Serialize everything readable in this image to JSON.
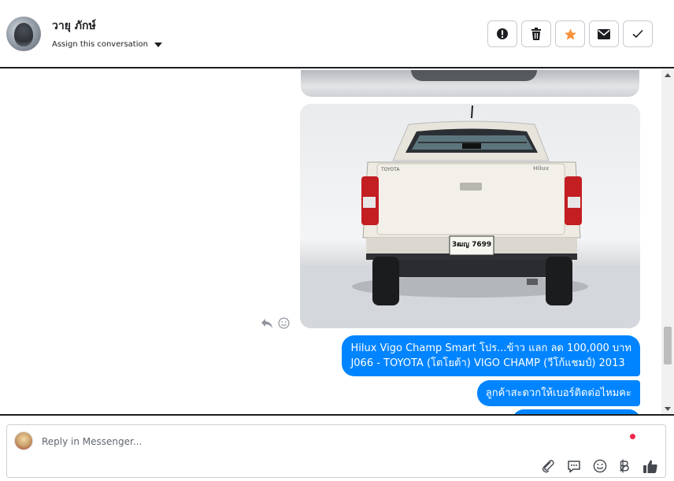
{
  "header": {
    "user_name": "วายุ ภักษ์",
    "assign_label": "Assign this conversation",
    "buttons": [
      {
        "name": "spam",
        "icon": "alert-icon"
      },
      {
        "name": "delete",
        "icon": "trash-icon"
      },
      {
        "name": "star",
        "icon": "star-icon",
        "color": "#f7923a"
      },
      {
        "name": "mark-unread",
        "icon": "envelope-icon"
      },
      {
        "name": "done",
        "icon": "check-icon"
      }
    ]
  },
  "messages": {
    "plate_text": "3ฒญ 7699",
    "car_brand": "TOYOTA",
    "car_model": "Hilux",
    "bubble_1_line_1": "Hilux Vigo Champ Smart โปร...ข้าว แลก ลด 100,000 บาท",
    "bubble_1_line_2": "J066 - TOYOTA (โตโยต้า) VIGO CHAMP (วีโก้แชมป์) 2013",
    "bubble_2": "ลูกค้าสะดวกให้เบอร์ติดต่อไหมคะ"
  },
  "composer": {
    "placeholder": "Reply in Messenger...",
    "tools": [
      "paperclip-icon",
      "saved-replies-icon",
      "emoji-icon",
      "baht-icon",
      "thumbs-up-icon"
    ]
  },
  "colors": {
    "bubble": "#0084ff",
    "accent_star": "#f7923a",
    "notification_dot": "#f02849"
  }
}
